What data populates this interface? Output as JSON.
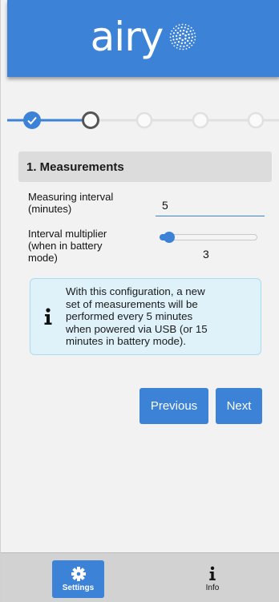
{
  "app": {
    "logo_text": "airy"
  },
  "stepper": {
    "steps": [
      {
        "state": "completed"
      },
      {
        "state": "current"
      },
      {
        "state": "pending"
      },
      {
        "state": "pending"
      },
      {
        "state": "pending"
      }
    ],
    "accent_color": "#3c82d6",
    "inactive_color": "#e0e0e0"
  },
  "section": {
    "title": "1. Measurements"
  },
  "fields": {
    "interval_label_line1": "Measuring interval",
    "interval_label_line2": "(minutes)",
    "interval_value": "5",
    "multiplier_label_line1": "Interval multiplier",
    "multiplier_label_line2": "(when in battery",
    "multiplier_label_line3": "mode)",
    "multiplier_value": "3",
    "multiplier_fraction": 0.1
  },
  "info": {
    "icon": "info-icon",
    "line1": "With this configuration, a new",
    "line2": "set of measurements will be",
    "line3": "performed every 5 minutes",
    "line4": "when powered via USB (or 15",
    "line5": "minutes in battery mode)."
  },
  "buttons": {
    "previous": "Previous",
    "next": "Next"
  },
  "bottom_nav": {
    "settings_label": "Settings",
    "settings_icon": "gear-icon",
    "info_label": "Info",
    "info_icon": "info-icon",
    "active_color": "#3c82d6"
  }
}
